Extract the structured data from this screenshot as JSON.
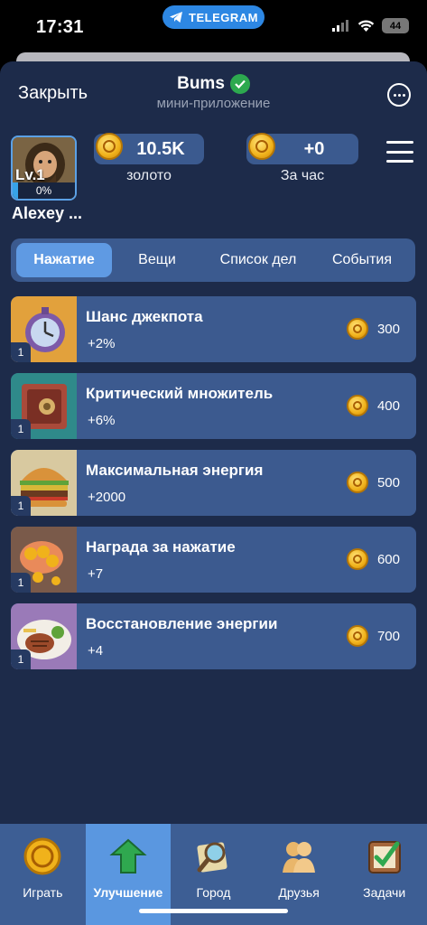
{
  "status_bar": {
    "time": "17:31",
    "telegram_label": "TELEGRAM",
    "battery": "44"
  },
  "header": {
    "close_label": "Закрыть",
    "title": "Bums",
    "subtitle": "мини-приложение"
  },
  "profile": {
    "level": "Lv.1",
    "progress_text": "0%",
    "progress": 0.0,
    "username": "Alexey ..."
  },
  "stats": {
    "gold_value": "10.5K",
    "gold_label": "золото",
    "hourly_value": "+0",
    "hourly_label": "За час"
  },
  "tabs": [
    {
      "label": "Нажатие",
      "active": true
    },
    {
      "label": "Вещи",
      "active": false
    },
    {
      "label": "Список дел",
      "active": false
    },
    {
      "label": "События",
      "active": false
    }
  ],
  "upgrades": [
    {
      "name": "Шанс джекпота",
      "bonus": "+2%",
      "price": "300",
      "level": "1",
      "icon": "stopwatch-icon"
    },
    {
      "name": "Критический множитель",
      "bonus": "+6%",
      "price": "400",
      "level": "1",
      "icon": "safe-icon"
    },
    {
      "name": "Максимальная энергия",
      "bonus": "+2000",
      "price": "500",
      "level": "1",
      "icon": "burger-icon"
    },
    {
      "name": "Награда за нажатие",
      "bonus": "+7",
      "price": "600",
      "level": "1",
      "icon": "coins-hand-icon"
    },
    {
      "name": "Восстановление энергии",
      "bonus": "+4",
      "price": "700",
      "level": "1",
      "icon": "steak-plate-icon"
    }
  ],
  "bottom_nav": [
    {
      "label": "Играть",
      "icon": "coin-icon",
      "active": false
    },
    {
      "label": "Улучшение",
      "icon": "arrow-up-icon",
      "active": true
    },
    {
      "label": "Город",
      "icon": "magnifier-map-icon",
      "active": false
    },
    {
      "label": "Друзья",
      "icon": "friends-icon",
      "active": false
    },
    {
      "label": "Задачи",
      "icon": "checkbox-icon",
      "active": false
    }
  ],
  "colors": {
    "background": "#1d2b4a",
    "card": "#3c5a8f",
    "accent": "#5f9ae3",
    "verified": "#2da94f",
    "coin": "#f0b21b"
  }
}
